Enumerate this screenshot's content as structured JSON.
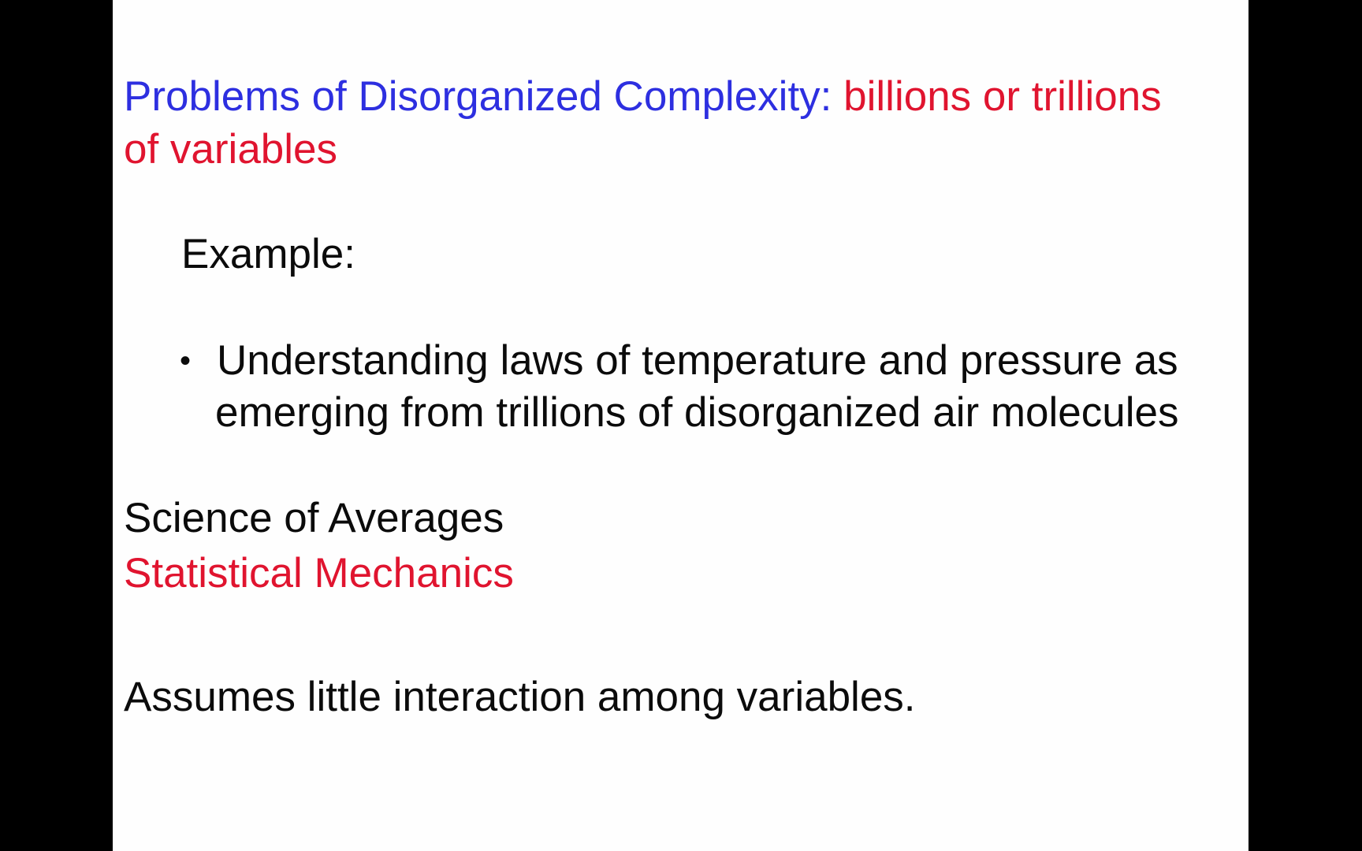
{
  "slide": {
    "title": {
      "part1": "Problems of Disorganized Complexity:",
      "part2": "billions or trillions",
      "line2": "of variables"
    },
    "example_label": "Example:",
    "bullet": {
      "marker": "•",
      "line1": "Understanding laws of temperature and pressure as",
      "line2": "emerging from trillions of disorganized air molecules"
    },
    "science_of_averages": "Science of Averages",
    "statistical_mechanics": "Statistical Mechanics",
    "assumption": "Assumes little interaction among variables."
  },
  "colors": {
    "title_blue": "#2d2fe0",
    "highlight_red": "#e0142f",
    "body_text": "#0b0b0b",
    "slide_background": "#fefefe",
    "letterbox": "#000000"
  }
}
